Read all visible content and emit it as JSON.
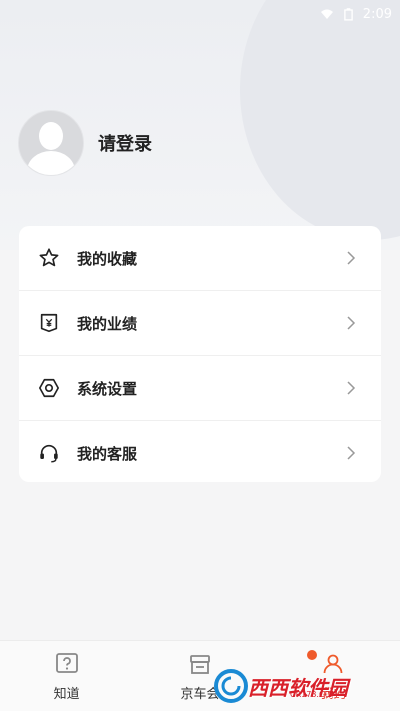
{
  "status_bar": {
    "time": "2:09"
  },
  "profile": {
    "login_label": "请登录"
  },
  "menu": {
    "items": [
      {
        "label": "我的收藏",
        "icon": "star-icon"
      },
      {
        "label": "我的业绩",
        "icon": "performance-icon"
      },
      {
        "label": "系统设置",
        "icon": "settings-icon"
      },
      {
        "label": "我的客服",
        "icon": "headset-icon"
      }
    ]
  },
  "tabbar": {
    "tabs": [
      {
        "label": "知道",
        "icon": "question-icon",
        "active": false
      },
      {
        "label": "京车会",
        "icon": "store-icon",
        "active": false
      },
      {
        "label": "我的",
        "icon": "user-icon",
        "active": true
      }
    ]
  },
  "watermark": {
    "brand": "西西软件园",
    "url": "CR173.COM"
  },
  "colors": {
    "accent": "#ef5a2b",
    "background": "#f5f5f6",
    "card": "#ffffff"
  }
}
